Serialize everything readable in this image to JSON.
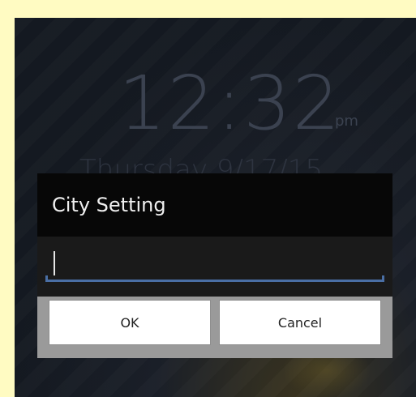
{
  "lockscreen": {
    "time": "12:32",
    "ampm": "pm",
    "date": "Thursday 9/17/15"
  },
  "dialog": {
    "title": "City Setting",
    "input_value": "",
    "ok_label": "OK",
    "cancel_label": "Cancel"
  }
}
